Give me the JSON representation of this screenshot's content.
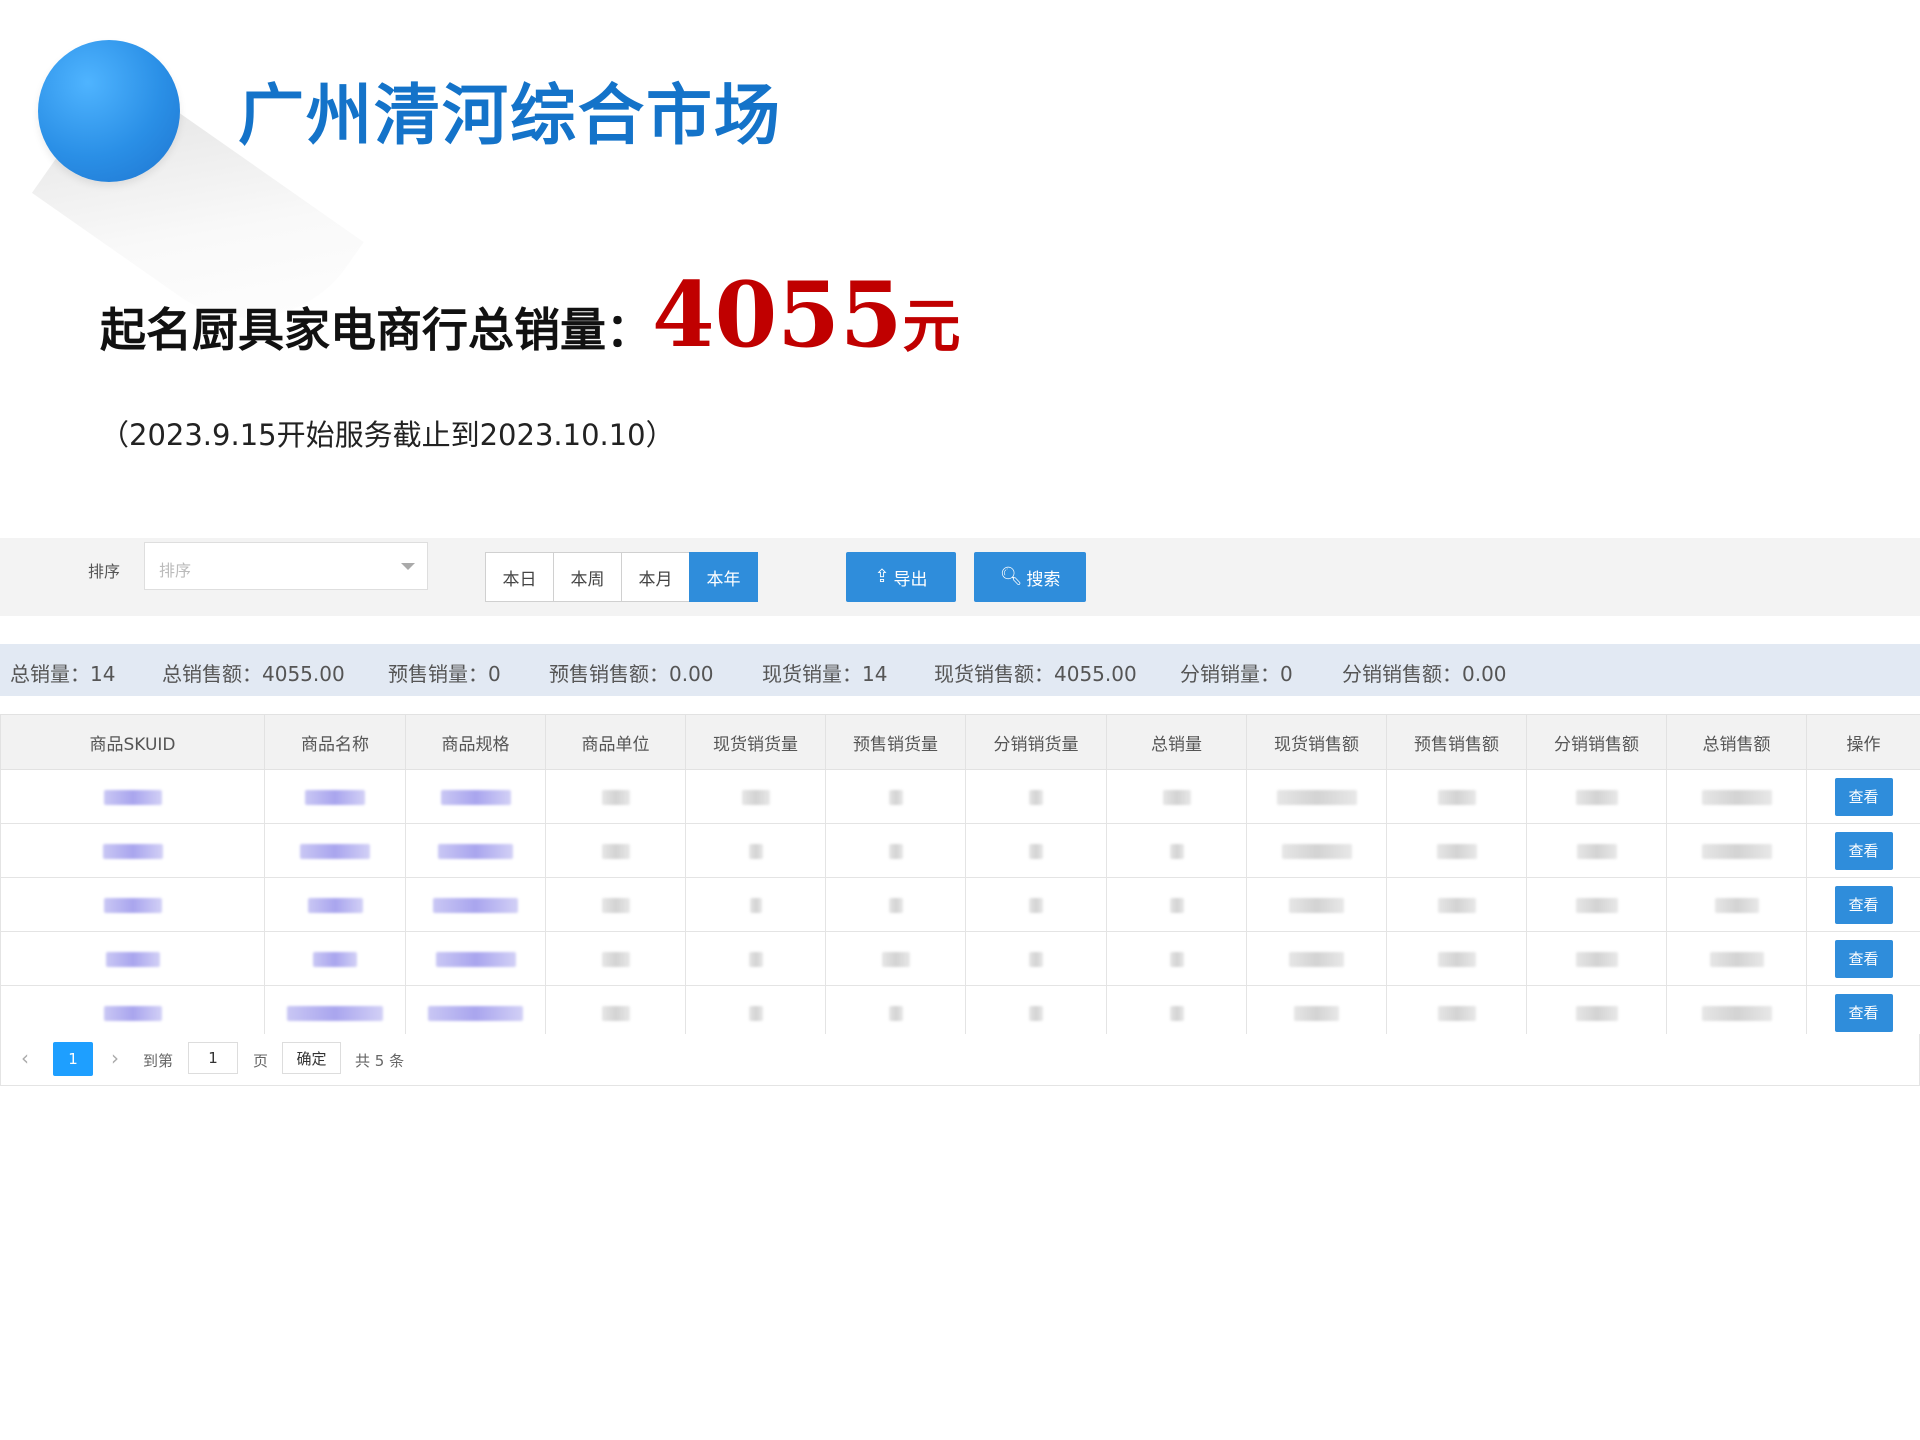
{
  "header": {
    "market_title": "广州清河综合市场",
    "summary_label": "起名厨具家电商行总销量：",
    "summary_value": "4055",
    "summary_unit": "元",
    "service_period": "（2023.9.15开始服务截止到2023.10.10）"
  },
  "toolbar": {
    "sort_label": "排序",
    "sort_placeholder": "排序",
    "ranges": [
      "本日",
      "本周",
      "本月",
      "本年"
    ],
    "active_range": "本年",
    "export_label": "导出",
    "search_label": "搜索",
    "accent": "#2f8ddb"
  },
  "stats": [
    {
      "label": "总销量：",
      "value": "14"
    },
    {
      "label": "总销售额：",
      "value": "4055.00"
    },
    {
      "label": "预售销量：",
      "value": "0"
    },
    {
      "label": "预售销售额：",
      "value": "0.00"
    },
    {
      "label": "现货销量：",
      "value": "14"
    },
    {
      "label": "现货销售额：",
      "value": "4055.00"
    },
    {
      "label": "分销销量：",
      "value": "0"
    },
    {
      "label": "分销销售额：",
      "value": "0.00"
    }
  ],
  "table": {
    "columns": [
      "商品SKUID",
      "商品名称",
      "商品规格",
      "商品单位",
      "现货销货量",
      "预售销货量",
      "分销销货量",
      "总销量",
      "现货销售额",
      "预售销售额",
      "分销销售额",
      "总销售额",
      "操作"
    ],
    "row_count": 5,
    "action_label": "查看"
  },
  "pagination": {
    "current_page": "1",
    "goto_label": "到第",
    "page_input_value": "1",
    "page_word": "页",
    "confirm_label": "确定",
    "total_label": "共 5 条"
  }
}
